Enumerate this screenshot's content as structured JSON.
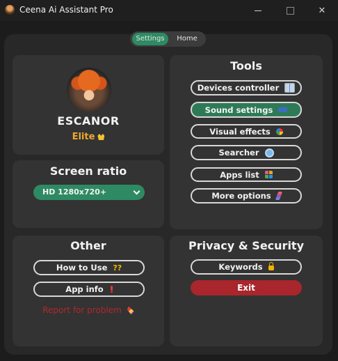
{
  "window": {
    "title": "Ceena Ai Assistant Pro",
    "minimize": "—",
    "maximize": "☐",
    "close": "✕"
  },
  "nav": {
    "tabs": [
      {
        "label": "Settings",
        "active": true
      },
      {
        "label": "Home",
        "active": false
      }
    ]
  },
  "profile": {
    "name": "ESCANOR",
    "rank": "Elite",
    "rank_icon": "crown-icon"
  },
  "screen_ratio": {
    "title": "Screen ratio",
    "selected": "HD 1280x720+"
  },
  "tools": {
    "title": "Tools",
    "items": [
      {
        "label": "Devices controller",
        "icon": "devices-icon",
        "active": false
      },
      {
        "label": "Sound settings",
        "icon": "sound-icon",
        "active": true
      },
      {
        "label": "Visual effects",
        "icon": "palette-icon",
        "active": false
      },
      {
        "label": "Searcher",
        "icon": "search-icon",
        "active": false
      },
      {
        "label": "Apps list",
        "icon": "apps-grid-icon",
        "active": false
      },
      {
        "label": "More options",
        "icon": "more-options-icon",
        "active": false
      }
    ]
  },
  "other": {
    "title": "Other",
    "how_to_use": "How to Use",
    "how_to_use_icon_text": "??",
    "app_info": "App info",
    "report": "Report for problem"
  },
  "privacy": {
    "title": "Privacy & Security",
    "keywords": "Keywords",
    "exit": "Exit"
  },
  "colors": {
    "accent_green": "#2e8a63",
    "exit_red": "#a8262c",
    "rank_gold": "#f0a92e",
    "card_bg": "#333333",
    "frame_bg": "#282828"
  }
}
